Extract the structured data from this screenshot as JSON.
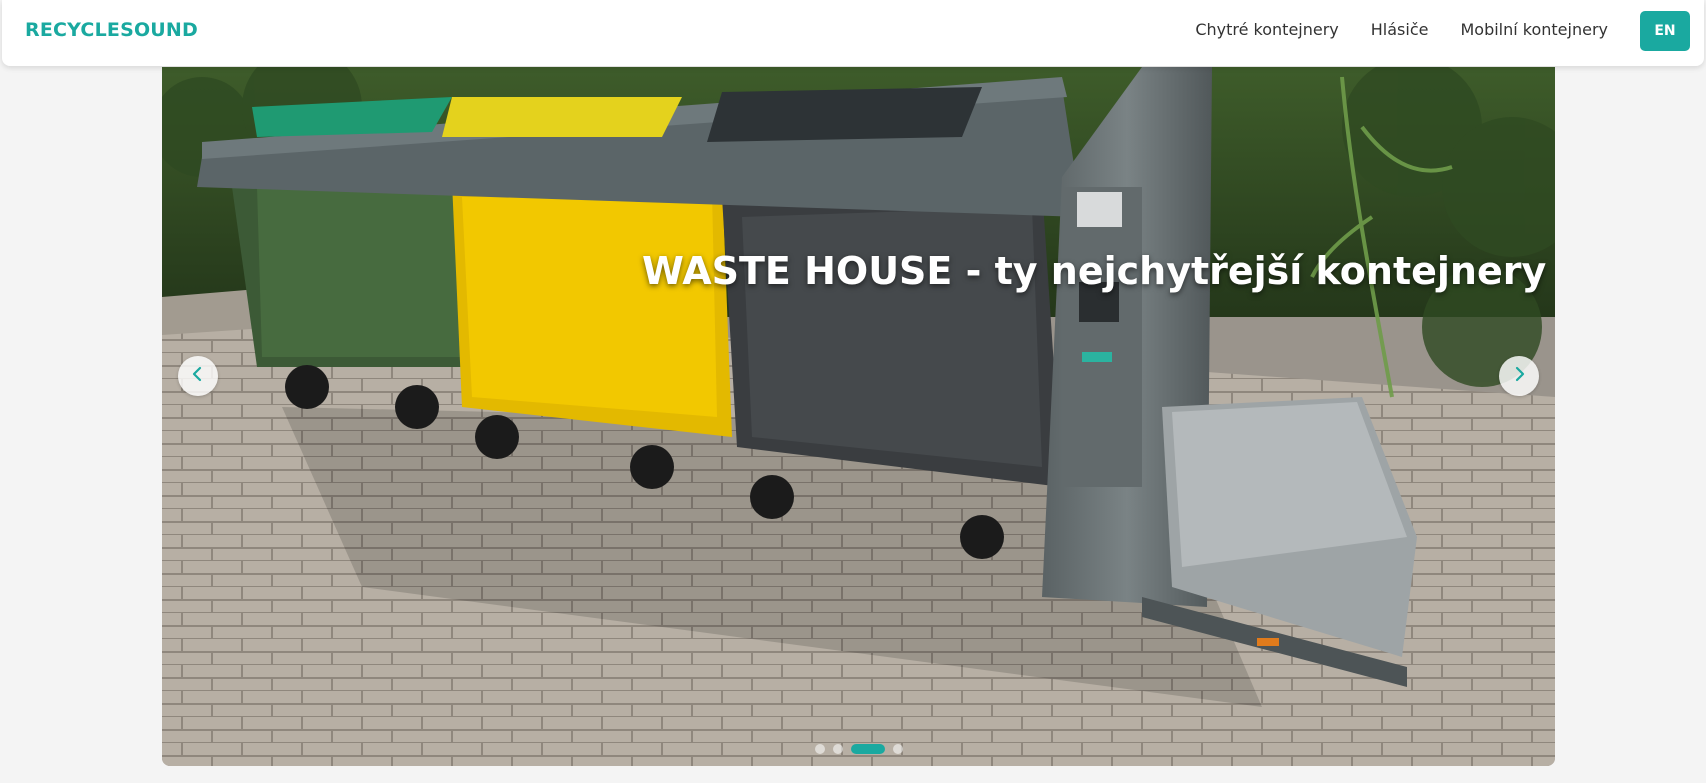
{
  "brand": {
    "name": "RECYCLESOUND"
  },
  "nav": {
    "items": [
      {
        "label": "Chytré kontejnery"
      },
      {
        "label": "Hlásiče"
      },
      {
        "label": "Mobilní kontejnery"
      }
    ],
    "language_button": "EN"
  },
  "carousel": {
    "caption": "WASTE HOUSE - ty nejchytřejší kontejnery",
    "slide_count": 4,
    "active_slide": 3,
    "prev_icon": "chevron-left-icon",
    "next_icon": "chevron-right-icon"
  },
  "colors": {
    "accent": "#1aa9a0",
    "nav_text": "#333333",
    "background": "#f4f4f4"
  }
}
